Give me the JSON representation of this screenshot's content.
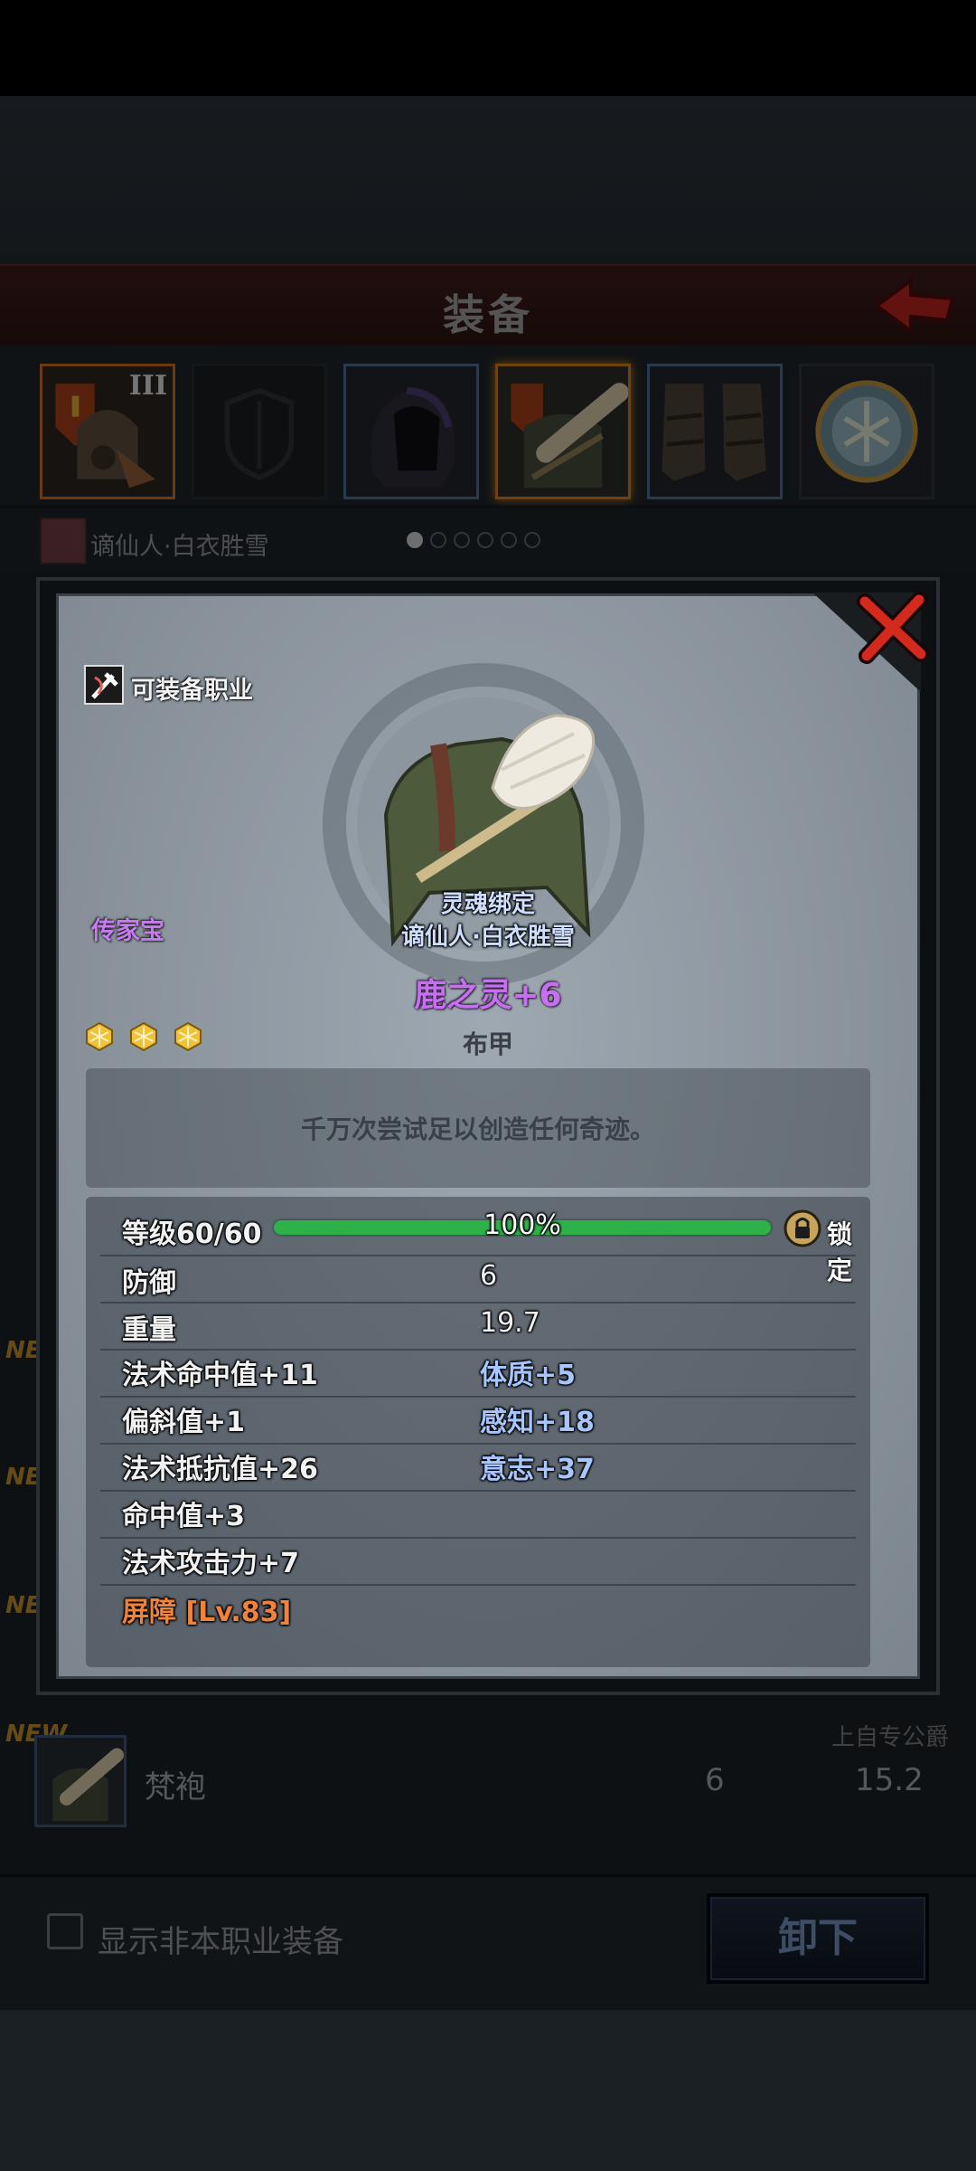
{
  "header": {
    "title": "装备"
  },
  "equipment_slots": [
    {
      "name": "helmet-slot",
      "badge": "III"
    },
    {
      "name": "empty-shield-slot"
    },
    {
      "name": "hood-slot"
    },
    {
      "name": "body-armor-slot"
    },
    {
      "name": "boots-slot"
    },
    {
      "name": "amulet-slot"
    }
  ],
  "hero": {
    "name": "谪仙人·白衣胜雪",
    "page_dots": 6,
    "current_page": 1
  },
  "list": {
    "new_tag": "NEW",
    "row": {
      "name": "梵袍",
      "value1": "6",
      "value2": "15.2",
      "hint": "上自专公爵"
    }
  },
  "bottom": {
    "checkbox_label": "显示非本职业装备",
    "unequip_label": "卸下"
  },
  "modal": {
    "class_label": "可装备职业",
    "heirloom": "传家宝",
    "soulbound": "灵魂绑定",
    "owner": "谪仙人·白衣胜雪",
    "item_name": "鹿之灵+6",
    "gems": 3,
    "armor_type": "布甲",
    "flavor": "千万次尝试足以创造任何奇迹。",
    "level": {
      "label": "等级60/60",
      "progress": 1.0,
      "percent": "100%",
      "lock_label": "锁定"
    },
    "stats": {
      "defense_label": "防御",
      "defense_value": "6",
      "weight_label": "重量",
      "weight_value": "19.7",
      "left": [
        "法术命中值+11",
        "偏斜值+1",
        "法术抵抗值+26",
        "命中值+3",
        "法术攻击力+7"
      ],
      "right": [
        "体质+5",
        "感知+18",
        "意志+37"
      ],
      "special": "屏障 [Lv.83]"
    }
  },
  "colors": {
    "item_rarity": "#c66ff0",
    "secondary_stat": "#a7c6ff",
    "special": "#f0823a",
    "bar": "#2fb14a"
  }
}
